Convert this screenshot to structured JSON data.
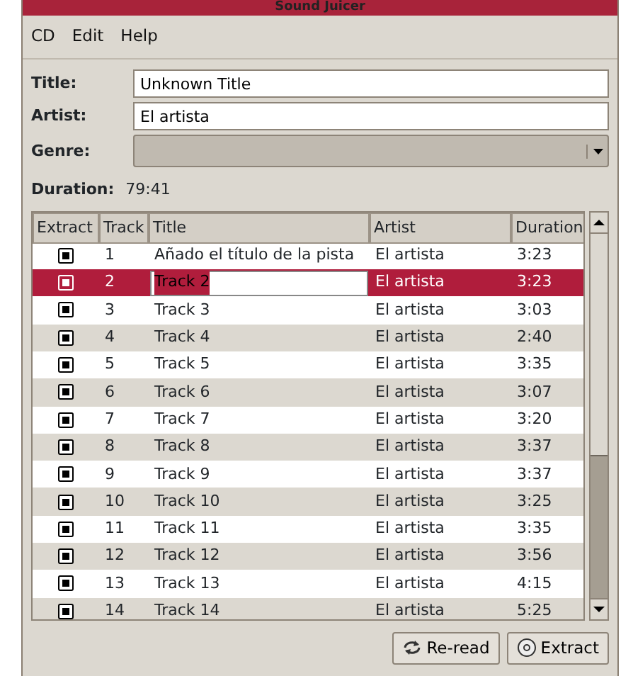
{
  "window": {
    "title": "Sound Juicer"
  },
  "menu": [
    "CD",
    "Edit",
    "Help"
  ],
  "fields": [
    {
      "label": "Title:",
      "kind": "text",
      "value": "Unknown Title"
    },
    {
      "label": "Artist:",
      "kind": "text",
      "value": "El artista"
    },
    {
      "label": "Genre:",
      "kind": "combo"
    }
  ],
  "duration": {
    "label": "Duration:",
    "value": "79:41"
  },
  "table": {
    "columns": [
      "Extract",
      "Track",
      "Title",
      "Artist",
      "Duration"
    ],
    "rows": [
      {
        "extract": true,
        "track": "1",
        "title": "Añado el título de la pista",
        "artist": "El artista",
        "duration": "3:23",
        "selected": false,
        "editing": false
      },
      {
        "extract": true,
        "track": "2",
        "title": "Track 2",
        "artist": "El artista",
        "duration": "3:23",
        "selected": true,
        "editing": true
      },
      {
        "extract": true,
        "track": "3",
        "title": "Track 3",
        "artist": "El artista",
        "duration": "3:03",
        "selected": false,
        "editing": false
      },
      {
        "extract": true,
        "track": "4",
        "title": "Track 4",
        "artist": "El artista",
        "duration": "2:40",
        "selected": false,
        "editing": false
      },
      {
        "extract": true,
        "track": "5",
        "title": "Track 5",
        "artist": "El artista",
        "duration": "3:35",
        "selected": false,
        "editing": false
      },
      {
        "extract": true,
        "track": "6",
        "title": "Track 6",
        "artist": "El artista",
        "duration": "3:07",
        "selected": false,
        "editing": false
      },
      {
        "extract": true,
        "track": "7",
        "title": "Track 7",
        "artist": "El artista",
        "duration": "3:20",
        "selected": false,
        "editing": false
      },
      {
        "extract": true,
        "track": "8",
        "title": "Track 8",
        "artist": "El artista",
        "duration": "3:37",
        "selected": false,
        "editing": false
      },
      {
        "extract": true,
        "track": "9",
        "title": "Track 9",
        "artist": "El artista",
        "duration": "3:37",
        "selected": false,
        "editing": false
      },
      {
        "extract": true,
        "track": "10",
        "title": "Track 10",
        "artist": "El artista",
        "duration": "3:25",
        "selected": false,
        "editing": false
      },
      {
        "extract": true,
        "track": "11",
        "title": "Track 11",
        "artist": "El artista",
        "duration": "3:35",
        "selected": false,
        "editing": false
      },
      {
        "extract": true,
        "track": "12",
        "title": "Track 12",
        "artist": "El artista",
        "duration": "3:56",
        "selected": false,
        "editing": false
      },
      {
        "extract": true,
        "track": "13",
        "title": "Track 13",
        "artist": "El artista",
        "duration": "4:15",
        "selected": false,
        "editing": false
      },
      {
        "extract": true,
        "track": "14",
        "title": "Track 14",
        "artist": "El artista",
        "duration": "5:25",
        "selected": false,
        "editing": false
      }
    ]
  },
  "buttons": [
    {
      "label": "Re-read",
      "kind": "reread"
    },
    {
      "label": "Extract",
      "kind": "extract"
    }
  ]
}
